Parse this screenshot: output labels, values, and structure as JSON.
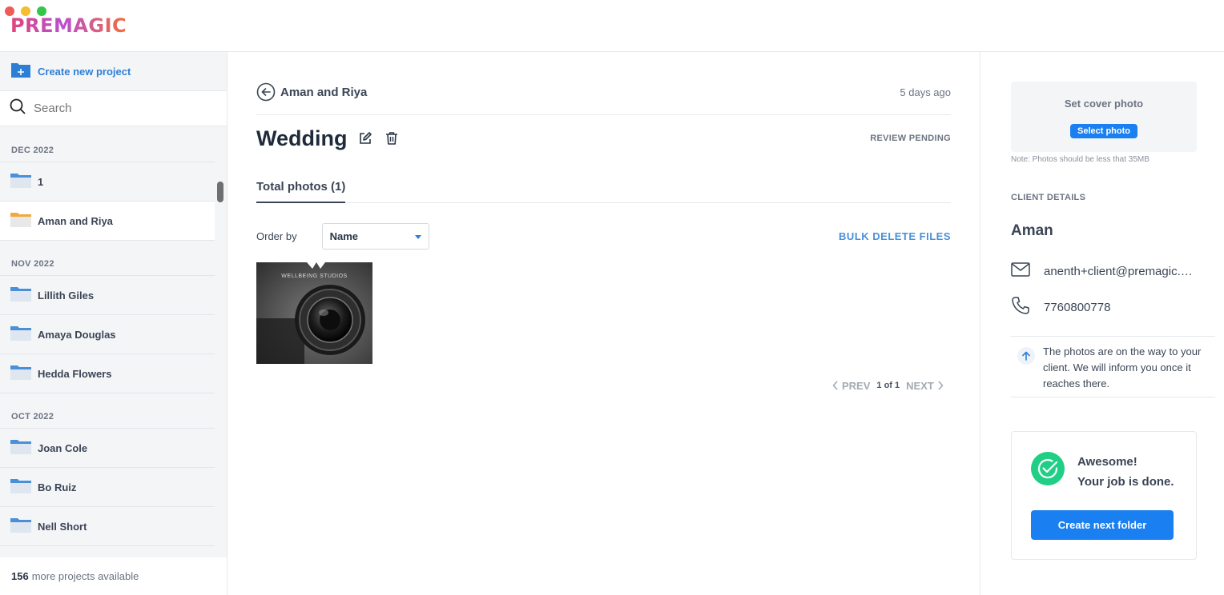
{
  "app": {
    "logo": "PREMAGIC"
  },
  "sidebar": {
    "create_label": "Create new project",
    "search_placeholder": "Search",
    "groups": [
      {
        "heading": "DEC 2022",
        "items": [
          {
            "name": "1"
          },
          {
            "name": "Aman and Riya",
            "active": true
          }
        ]
      },
      {
        "heading": "NOV 2022",
        "items": [
          {
            "name": "Lillith Giles"
          },
          {
            "name": "Amaya Douglas"
          },
          {
            "name": "Hedda Flowers"
          }
        ]
      },
      {
        "heading": "OCT 2022",
        "items": [
          {
            "name": "Joan Cole"
          },
          {
            "name": "Bo Ruiz"
          },
          {
            "name": "Nell Short"
          }
        ]
      }
    ],
    "footer_count": "156",
    "footer_text": "more projects available"
  },
  "main": {
    "breadcrumb": "Aman and Riya",
    "time_ago": "5 days ago",
    "title": "Wedding",
    "status": "REVIEW PENDING",
    "tab_label": "Total photos (1)",
    "order_label": "Order by",
    "order_value": "Name",
    "bulk_delete": "BULK DELETE FILES",
    "photo_watermark": "WELLBEING STUDIOS",
    "pager": {
      "prev": "PREV",
      "page": "1 of 1",
      "next": "NEXT"
    }
  },
  "right": {
    "cover_title": "Set cover photo",
    "cover_button": "Select photo",
    "cover_note": "Note: Photos should be less that 35MB",
    "client_heading": "CLIENT DETAILS",
    "client_name": "Aman",
    "client_email": "anenth+client@premagic.com",
    "client_phone": "7760800778",
    "status_message": "The photos are on the way to your client. We will inform you once it reaches there.",
    "done_line1": "Awesome!",
    "done_line2": "Your job is done.",
    "done_button": "Create next folder"
  },
  "colors": {
    "accent": "#1a7ff0",
    "success": "#1fcf86",
    "folder": "#4a90d9",
    "folder_active": "#f0a93c"
  }
}
